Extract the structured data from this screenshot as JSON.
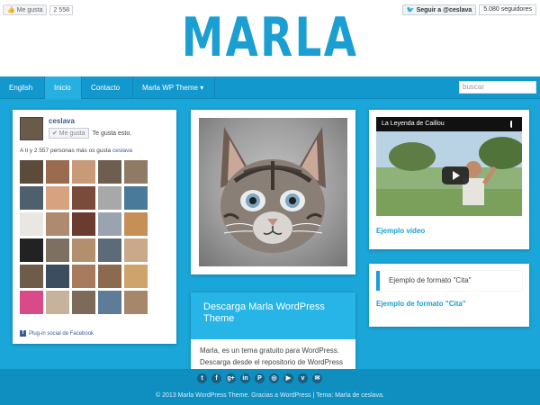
{
  "site": {
    "title": "MARLA"
  },
  "top": {
    "fb_like_label": "Me gusta",
    "fb_like_count": "2 558",
    "twitter_follow": "Seguir a @ceslava",
    "twitter_followers": "5.080 seguidores"
  },
  "nav": {
    "items": [
      {
        "label": "English"
      },
      {
        "label": "Inicio"
      },
      {
        "label": "Contacto"
      },
      {
        "label": "Marla WP Theme"
      }
    ],
    "search_placeholder": "buscar",
    "chevron": "▾"
  },
  "fb_box": {
    "name": "ceslava",
    "like_button": "✔ Me gusta",
    "like_text": "Te gusta esto.",
    "count_text": "A ti y 2 557 personas más os gusta",
    "count_link": "ceslava",
    "plugin_label": "Plug-in social de Facebook",
    "face_colors": [
      "#5c4a3a",
      "#9a6b4f",
      "#c89a7a",
      "#6d5e4f",
      "#8f7b65",
      "#4e5f6e",
      "#d6a27f",
      "#7a4b3a",
      "#a8a8a8",
      "#4a7a9a",
      "#eae7e2",
      "#b08a6e",
      "#6c3b2f",
      "#9aa4b0",
      "#c68f57",
      "#222222",
      "#7d7060",
      "#b48f6d",
      "#5d6b78",
      "#c9a98a",
      "#6f5b4a",
      "#3c4d5f",
      "#a87b5c",
      "#8c6a4f",
      "#cfa36c",
      "#d94a88",
      "#c7b29c",
      "#7e6a5b",
      "#5e7b98",
      "#a7876c"
    ]
  },
  "post": {
    "title": "Descarga Marla WordPress Theme",
    "body": "Marla, es un tema gratuito para WordPress. Descarga desde el repositorio de WordPress"
  },
  "video": {
    "title": "La Leyenda de Caillou",
    "link": "Ejemplo vídeo"
  },
  "quote": {
    "text": "Ejemplo de formato \"Cita\"",
    "link": "Ejemplo de formato \"Cita\""
  },
  "footer": {
    "socials": [
      "t",
      "f",
      "g+",
      "in",
      "P",
      "◎",
      "▶",
      "v",
      "✉"
    ],
    "copyright": "© 2013 Marla WordPress Theme. Gracias a WordPress | Tema: Marla de ceslava."
  },
  "colors": {
    "accent": "#1b9fd3",
    "background": "#1aa6d8",
    "nav": "#1298cc"
  }
}
